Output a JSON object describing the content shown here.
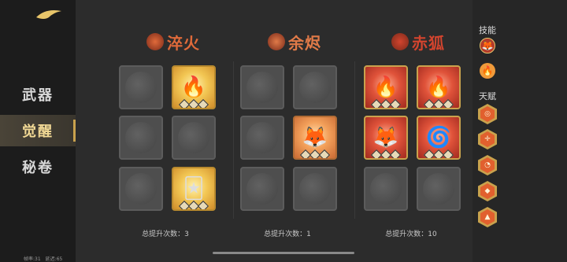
{
  "nav": {
    "items": [
      {
        "label": "武器"
      },
      {
        "label": "觉醒"
      },
      {
        "label": "秘卷"
      }
    ]
  },
  "columns": [
    {
      "title": "淬火",
      "color": "#e06a3a",
      "total_label": "总提升次数：3"
    },
    {
      "title": "余烬",
      "color": "#e07a48",
      "total_label": "总提升次数：1"
    },
    {
      "title": "赤狐",
      "color": "#d2442e",
      "total_label": "总提升次数：10"
    }
  ],
  "tiles": [
    {
      "state": "locked",
      "glyph": "",
      "diamonds": 0
    },
    {
      "state": "gold",
      "glyph": "🔥",
      "diamonds": 3
    },
    {
      "state": "locked",
      "glyph": "",
      "diamonds": 0
    },
    {
      "state": "locked",
      "glyph": "",
      "diamonds": 0
    },
    {
      "state": "locked",
      "glyph": "",
      "diamonds": 0
    },
    {
      "state": "gold",
      "glyph": "🃏",
      "diamonds": 3
    },
    {
      "state": "locked",
      "glyph": "",
      "diamonds": 0
    },
    {
      "state": "locked",
      "glyph": "",
      "diamonds": 0
    },
    {
      "state": "locked",
      "glyph": "",
      "diamonds": 0
    },
    {
      "state": "orange",
      "glyph": "🦊",
      "diamonds": 3
    },
    {
      "state": "locked",
      "glyph": "",
      "diamonds": 0
    },
    {
      "state": "locked",
      "glyph": "",
      "diamonds": 0
    },
    {
      "state": "red",
      "glyph": "🔥",
      "diamonds": 3
    },
    {
      "state": "red",
      "glyph": "🔥",
      "diamonds": 3
    },
    {
      "state": "red",
      "glyph": "🦊",
      "diamonds": 3
    },
    {
      "state": "red",
      "glyph": "🌀",
      "diamonds": 3
    },
    {
      "state": "locked",
      "glyph": "",
      "diamonds": 0
    },
    {
      "state": "locked",
      "glyph": "",
      "diamonds": 0
    }
  ],
  "sidebar": {
    "skills_label": "技能",
    "talent_label": "天赋",
    "skill_icons": [
      "fox-mask-icon",
      "fireball-icon"
    ],
    "talent_icons": [
      "swirl-icon",
      "target-icon",
      "fox-head-icon",
      "flame-icon",
      "ember-icon"
    ]
  },
  "status": {
    "fps": "帧率:31",
    "latency": "延迟:65"
  }
}
